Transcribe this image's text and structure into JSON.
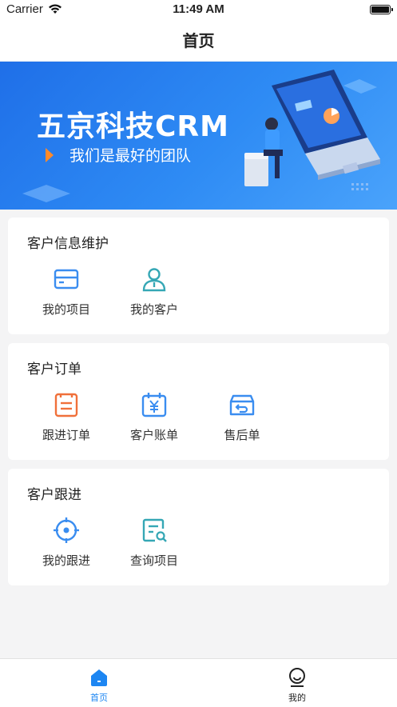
{
  "status": {
    "carrier": "Carrier",
    "time": "11:49 AM"
  },
  "nav": {
    "title": "首页"
  },
  "banner": {
    "title": "五京科技CRM",
    "subtitle": "我们是最好的团队"
  },
  "sections": [
    {
      "title": "客户信息维护",
      "items": [
        {
          "label": "我的项目",
          "icon": "project-card-icon"
        },
        {
          "label": "我的客户",
          "icon": "customer-person-icon"
        }
      ]
    },
    {
      "title": "客户订单",
      "items": [
        {
          "label": "跟进订单",
          "icon": "order-list-icon"
        },
        {
          "label": "客户账单",
          "icon": "bill-yuan-icon"
        },
        {
          "label": "售后单",
          "icon": "after-sales-box-icon"
        }
      ]
    },
    {
      "title": "客户跟进",
      "items": [
        {
          "label": "我的跟进",
          "icon": "follow-target-icon"
        },
        {
          "label": "查询项目",
          "icon": "search-document-icon"
        }
      ]
    }
  ],
  "tabs": [
    {
      "label": "首页",
      "icon": "home-icon",
      "active": true
    },
    {
      "label": "我的",
      "icon": "profile-icon",
      "active": false
    }
  ],
  "colors": {
    "accent": "#1d86f2",
    "blue_icon": "#3a8df0",
    "teal_icon": "#35a7b5",
    "orange_icon": "#f0703a"
  }
}
